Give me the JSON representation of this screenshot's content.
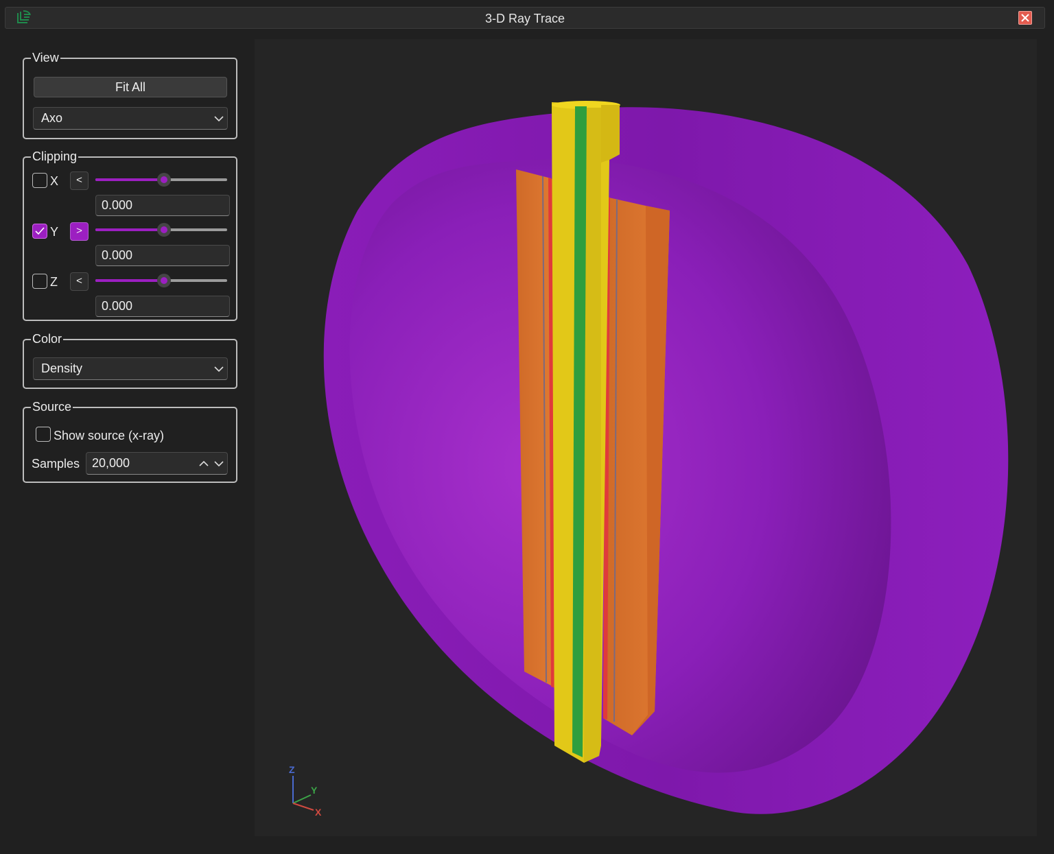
{
  "window": {
    "title": "3-D Ray Trace"
  },
  "icons": {
    "app": "app-logo-icon",
    "close": "close-icon"
  },
  "view": {
    "legend": "View",
    "fit_all_label": "Fit All",
    "projection": "Axo"
  },
  "clipping": {
    "legend": "Clipping",
    "axes": [
      {
        "name": "X",
        "checked": false,
        "direction": "<",
        "slider_fraction": 0.52,
        "value": "0.000"
      },
      {
        "name": "Y",
        "checked": true,
        "direction": ">",
        "slider_fraction": 0.52,
        "value": "0.000"
      },
      {
        "name": "Z",
        "checked": false,
        "direction": "<",
        "slider_fraction": 0.52,
        "value": "0.000"
      }
    ]
  },
  "color": {
    "legend": "Color",
    "mode": "Density"
  },
  "source": {
    "legend": "Source",
    "show_source_label": "Show source (x-ray)",
    "show_source_checked": false,
    "samples_label": "Samples",
    "samples_value": "20,000"
  },
  "triad": {
    "z": "Z",
    "y": "Y",
    "x": "X"
  },
  "colors": {
    "accent": "#9c1fc1",
    "shell": "#8a1db8",
    "rod": "#e2c818",
    "core": "#2f9e3e",
    "sleeve": "#d9702c",
    "gap": "#e03a3a"
  }
}
